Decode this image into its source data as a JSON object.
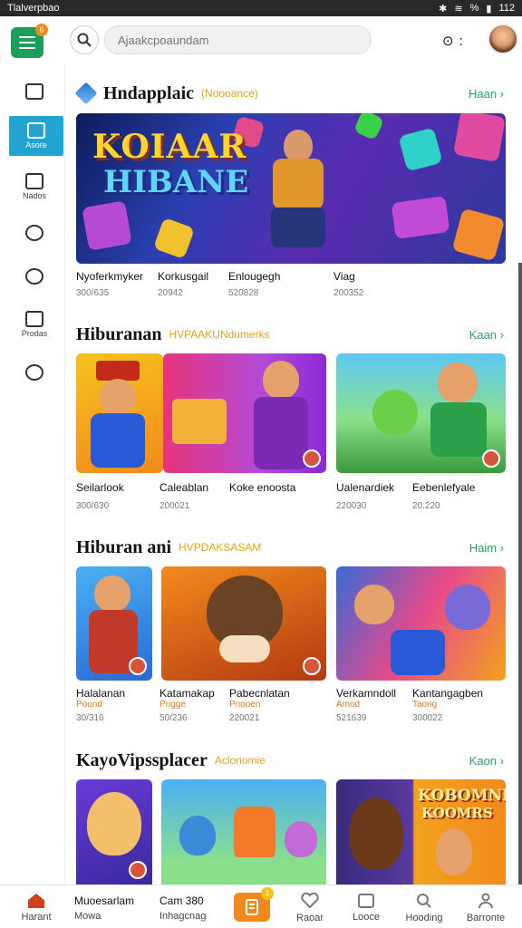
{
  "statusbar": {
    "app_name": "Tlalverpbao",
    "time": "112",
    "battery": "%"
  },
  "header": {
    "menu_badge": "6",
    "search_placeholder": "Ajaakcpoaundam",
    "right_label": "0"
  },
  "sidebar": {
    "items": [
      {
        "label": "",
        "icon": "clipboard-icon"
      },
      {
        "label": "Asore",
        "icon": "store-icon"
      },
      {
        "label": "Nados",
        "icon": "bag-icon"
      },
      {
        "label": "",
        "icon": "compass-icon"
      },
      {
        "label": "",
        "icon": "puzzle-icon"
      },
      {
        "label": "Prodas",
        "icon": "calendar-icon"
      },
      {
        "label": "",
        "icon": "shell-icon"
      }
    ]
  },
  "sections": [
    {
      "title": "Hndapplaic",
      "tag": "(Noooance)",
      "more": "Haan",
      "banner_line1": "KOIAAR",
      "banner_line2": "HIBANE",
      "items": [
        {
          "name": "Nyoferkmyker",
          "meta": "300/635"
        },
        {
          "name": "Korkusgail",
          "meta": "20942"
        },
        {
          "name": "Enlougegh",
          "meta": "520828"
        },
        {
          "name": "Viag",
          "meta": "200352"
        }
      ]
    },
    {
      "title": "Hiburanan",
      "tag": "HVPAAKUNdumerks",
      "more": "Kaan",
      "items": [
        {
          "name": "Seilarlook",
          "meta": "300/630"
        },
        {
          "name": "Caleablan",
          "meta": "200021"
        },
        {
          "name": "Koke enoosta",
          "meta": ""
        },
        {
          "name": "Ualenardiek",
          "meta": "220030"
        },
        {
          "name": "Eebenlefyale",
          "meta": "20.220"
        }
      ]
    },
    {
      "title": "Hiburan ani",
      "tag": "HVPDAKSASAM",
      "more": "Haim",
      "items": [
        {
          "name": "Halalanan",
          "sub": "Pound",
          "meta": "30/316"
        },
        {
          "name": "Katamakap",
          "sub": "Prigge",
          "meta": "50/236"
        },
        {
          "name": "Pabecnlatan",
          "sub": "Pnooen",
          "meta": "220021"
        },
        {
          "name": "Verkamndoll",
          "sub": "Amod",
          "meta": "521639"
        },
        {
          "name": "Kantangagben",
          "sub": "Taong",
          "meta": "300022"
        }
      ]
    },
    {
      "title": "KayoVipssplacer",
      "tag": "Aclonomie",
      "more": "Kaon",
      "card4_line1": "KOBOMNE",
      "card4_line2": "KOOMRS"
    }
  ],
  "bottom_nav": [
    {
      "label": "Harant",
      "icon": "home-icon"
    },
    {
      "label": "Muoesarlam",
      "sub": "Mowa"
    },
    {
      "label": "Cam 380",
      "sub": "Inhagcnag"
    },
    {
      "label": "",
      "icon": "document-icon",
      "badge": "1"
    },
    {
      "label": "Raoar",
      "icon": "heart-icon"
    },
    {
      "label": "Looce",
      "icon": "square-icon"
    },
    {
      "label": "Hooding",
      "icon": "search-icon"
    },
    {
      "label": "Barronte",
      "icon": "person-icon"
    }
  ],
  "colors": {
    "accent_green": "#1aa05a",
    "accent_blue": "#21a3d4",
    "accent_orange": "#f08a1c",
    "tag_gold": "#e6a21a"
  }
}
